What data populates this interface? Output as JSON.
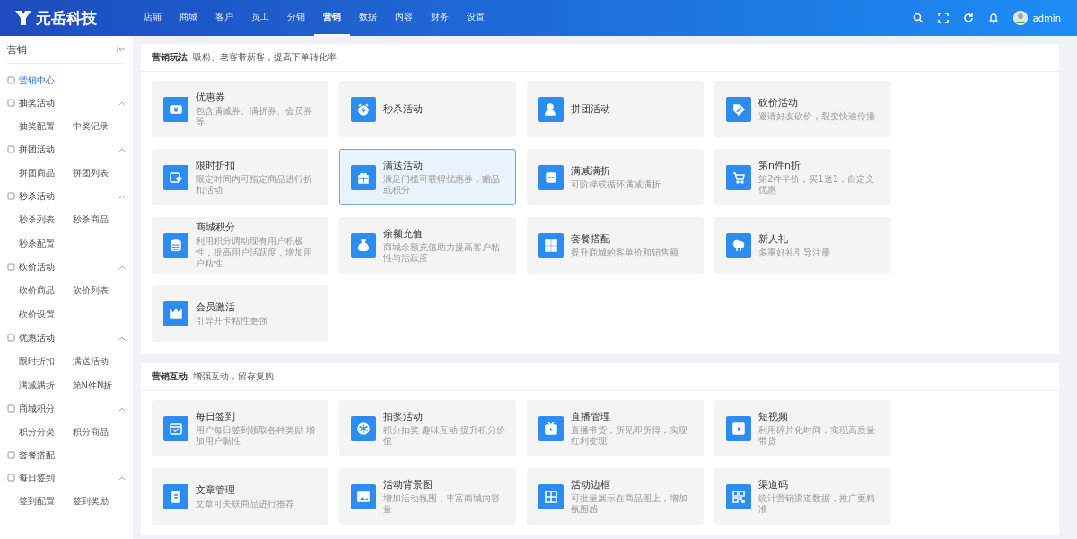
{
  "header": {
    "logo": "元岳科技",
    "nav": [
      {
        "label": "店铺",
        "selected": false
      },
      {
        "label": "商城",
        "selected": false
      },
      {
        "label": "客户",
        "selected": false
      },
      {
        "label": "员工",
        "selected": false
      },
      {
        "label": "分销",
        "selected": false
      },
      {
        "label": "营销",
        "selected": true
      },
      {
        "label": "数据",
        "selected": false
      },
      {
        "label": "内容",
        "selected": false
      },
      {
        "label": "财务",
        "selected": false
      },
      {
        "label": "设置",
        "selected": false
      }
    ],
    "user": "admin"
  },
  "sidebar": {
    "title": "营销",
    "items": [
      {
        "kind": "link",
        "label": "营销中心",
        "selected": true
      },
      {
        "kind": "group",
        "label": "抽奖活动",
        "expanded": true,
        "children": [
          "抽奖配置",
          "中奖记录"
        ]
      },
      {
        "kind": "group",
        "label": "拼团活动",
        "expanded": true,
        "children": [
          "拼团商品",
          "拼团列表"
        ]
      },
      {
        "kind": "group",
        "label": "秒杀活动",
        "expanded": true,
        "children": [
          "秒杀列表",
          "秒杀商品",
          "秒杀配置"
        ]
      },
      {
        "kind": "group",
        "label": "砍价活动",
        "expanded": true,
        "children": [
          "砍价商品",
          "砍价列表",
          "砍价设置"
        ]
      },
      {
        "kind": "group",
        "label": "优惠活动",
        "expanded": true,
        "children": [
          "限时折扣",
          "满送活动",
          "满减满折",
          "第N件N折"
        ]
      },
      {
        "kind": "group",
        "label": "商城积分",
        "expanded": true,
        "children": [
          "积分分类",
          "积分商品"
        ]
      },
      {
        "kind": "link",
        "label": "套餐搭配",
        "selected": false
      },
      {
        "kind": "group",
        "label": "每日签到",
        "expanded": true,
        "children": [
          "签到配置",
          "签到奖励"
        ]
      }
    ]
  },
  "sections": [
    {
      "title": "营销玩法",
      "subtitle": "吸粉、老客带新客，提高下单转化率",
      "cards": [
        {
          "title": "优惠券",
          "description": "包含满减券、满折券、会员券等",
          "selected": false
        },
        {
          "title": "秒杀活动",
          "selected": false
        },
        {
          "title": "拼团活动",
          "selected": false
        },
        {
          "title": "砍价活动",
          "description": "邀请好友砍价，裂变快速传播",
          "selected": false
        },
        {
          "title": "限时折扣",
          "description": "限定时间内可指定商品进行折扣活动",
          "selected": false
        },
        {
          "title": "满送活动",
          "description": "满足门槛可获得优惠券，赠品或积分",
          "selected": true
        },
        {
          "title": "满减满折",
          "description": "可阶梯或循环满减满折",
          "selected": false
        },
        {
          "title": "第n件n折",
          "description": "第2件半价，买1送1，自定义优惠",
          "selected": false
        },
        {
          "title": "商城积分",
          "description": "利用积分调动现有用户积极性，提高用户活跃度，增加用户粘性",
          "selected": false
        },
        {
          "title": "余额充值",
          "description": "商城余额充值助力提高客户粘性与活跃度",
          "selected": false
        },
        {
          "title": "套餐搭配",
          "description": "提升商城的客单价和销售额",
          "selected": false
        },
        {
          "title": "新人礼",
          "description": "多重好礼引导注册",
          "selected": false
        },
        {
          "title": "会员激活",
          "description": "引导开卡粘性更强",
          "selected": false
        }
      ]
    },
    {
      "title": "营销互动",
      "subtitle": "增强互动，留存复购",
      "cards": [
        {
          "title": "每日签到",
          "description": "用户每日签到领取各种奖励 增加用户黏性",
          "selected": false
        },
        {
          "title": "抽奖活动",
          "description": "积分抽奖 趣味互动 提升积分价值",
          "selected": false
        },
        {
          "title": "直播管理",
          "description": "直播带货，所见即所得，实现红利变现",
          "selected": false
        },
        {
          "title": "短视频",
          "description": "利用碎片化时间，实现高质量带货",
          "selected": false
        },
        {
          "title": "文章管理",
          "description": "文章可关联商品进行推荐",
          "selected": false
        },
        {
          "title": "活动背景图",
          "description": "增加活动氛围，丰富商城内容量",
          "selected": false
        },
        {
          "title": "活动边框",
          "description": "可批量展示在商品图上，增加氛围感",
          "selected": false
        },
        {
          "title": "渠道码",
          "description": "统计营销渠道数据，推广更精准",
          "selected": false
        }
      ]
    }
  ]
}
